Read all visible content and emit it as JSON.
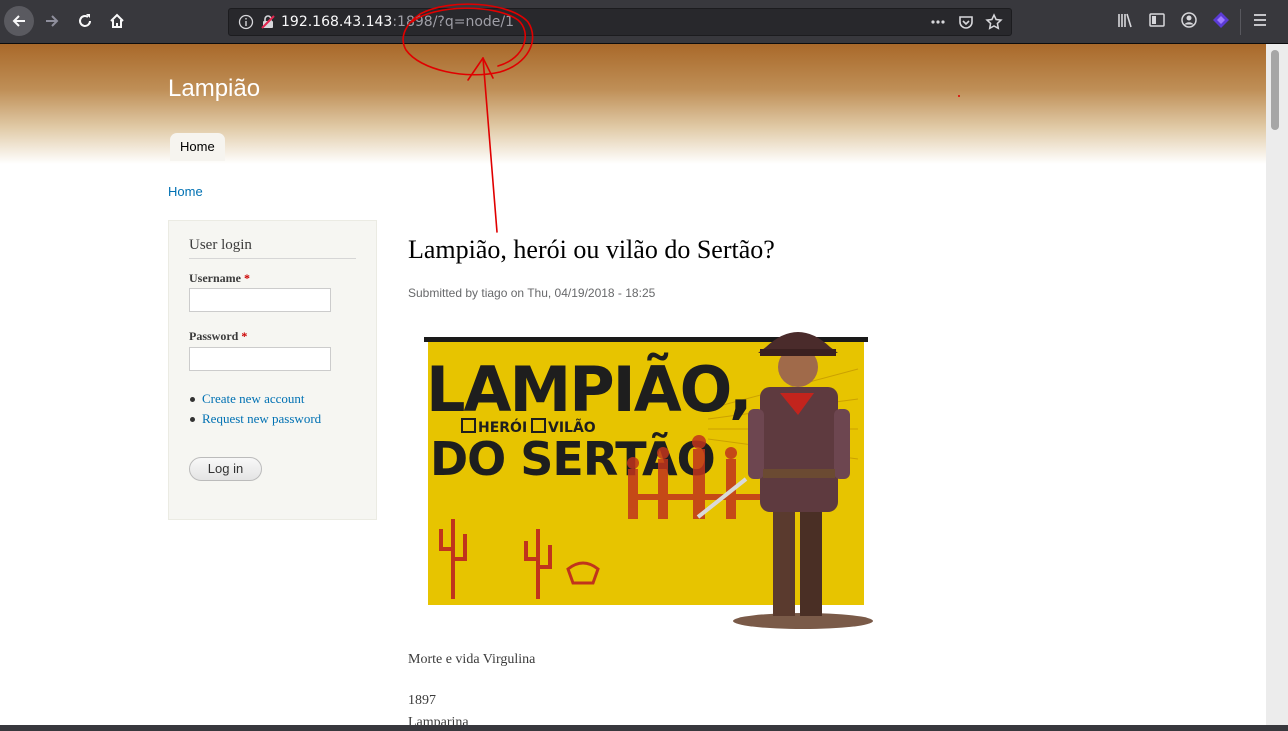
{
  "browser": {
    "url_host": "192.168.43.143",
    "url_rest": ":1898/?q=node/1",
    "icons": [
      "back-arrow-icon",
      "forward-arrow-icon",
      "reload-icon",
      "home-icon",
      "info-icon",
      "insecure-lock-icon",
      "more-actions-icon",
      "pocket-icon",
      "bookmark-star-icon",
      "library-icon",
      "sidebar-icon",
      "account-icon",
      "extension-icon",
      "menu-icon"
    ]
  },
  "site": {
    "name": "Lampião",
    "tabs": [
      "Home"
    ],
    "breadcrumb": "Home"
  },
  "login_block": {
    "title": "User login",
    "username_label": "Username",
    "password_label": "Password",
    "required_mark": "*",
    "links": [
      "Create new account",
      "Request new password"
    ],
    "submit_label": "Log in"
  },
  "node": {
    "title": "Lampião, herói ou vilão do Sertão?",
    "submitted": "Submitted by tiago on Thu, 04/19/2018 - 18:25",
    "body": [
      "Morte e vida Virgulina",
      "1897",
      "Lamparina"
    ],
    "image": {
      "title_line1": "LAMPIÃO,",
      "option1": "HERÓI",
      "option2": "VILÃO",
      "title_line2": "DO SERTÃO"
    }
  },
  "colors": {
    "chrome_bg": "#38383d",
    "link": "#0071b3",
    "header_top": "#a9692a",
    "poster_yellow": "#e7c400",
    "annotation_red": "#e00000"
  }
}
